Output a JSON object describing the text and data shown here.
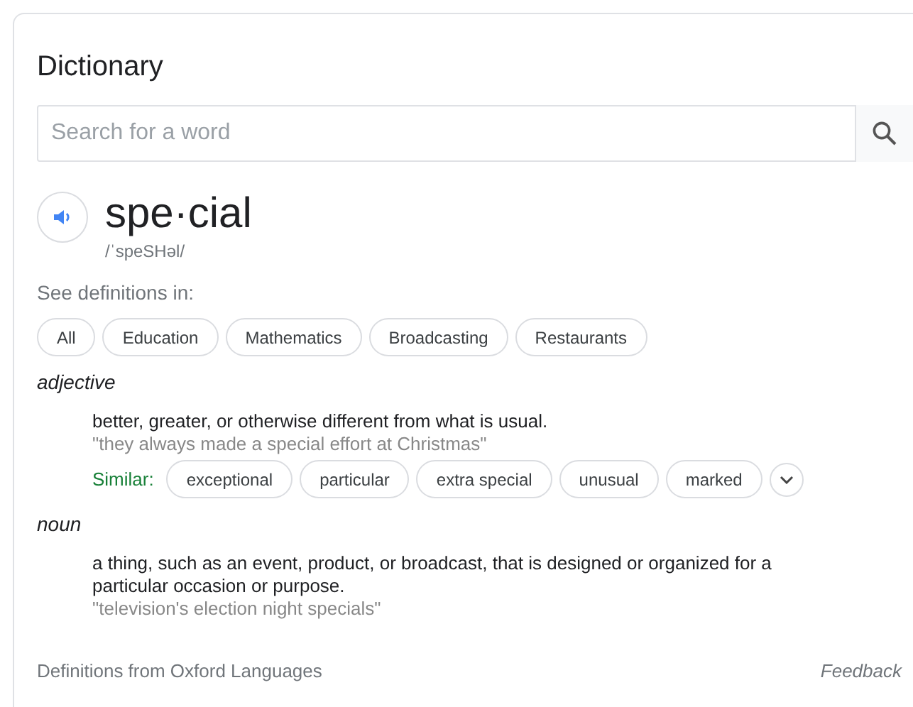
{
  "title": "Dictionary",
  "search": {
    "placeholder": "Search for a word"
  },
  "word": "spe·cial",
  "pronunciation": "/ˈspeSHəl/",
  "see_definitions_label": "See definitions in:",
  "categories": [
    {
      "label": "All"
    },
    {
      "label": "Education"
    },
    {
      "label": "Mathematics"
    },
    {
      "label": "Broadcasting"
    },
    {
      "label": "Restaurants"
    }
  ],
  "senses": [
    {
      "part_of_speech": "adjective",
      "definition": "better, greater, or otherwise different from what is usual.",
      "example": "\"they always made a special effort at Christmas\"",
      "similar_label": "Similar:",
      "similar": [
        "exceptional",
        "particular",
        "extra special",
        "unusual",
        "marked"
      ]
    },
    {
      "part_of_speech": "noun",
      "definition": "a thing, such as an event, product, or broadcast, that is designed or organized for a particular occasion or purpose.",
      "example": "\"television's election night specials\""
    }
  ],
  "footer": {
    "source": "Definitions from Oxford Languages",
    "feedback": "Feedback"
  }
}
